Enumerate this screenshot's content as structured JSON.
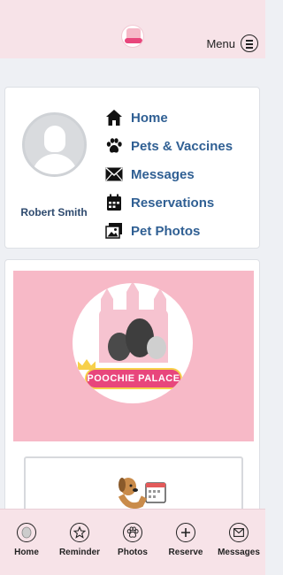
{
  "header": {
    "menu_label": "Menu"
  },
  "profile": {
    "name": "Robert Smith",
    "nav": [
      {
        "label": "Home",
        "icon": "home-icon"
      },
      {
        "label": "Pets & Vaccines",
        "icon": "paw-icon"
      },
      {
        "label": "Messages",
        "icon": "envelope-icon"
      },
      {
        "label": "Reservations",
        "icon": "calendar-icon"
      },
      {
        "label": "Pet Photos",
        "icon": "photos-icon"
      }
    ]
  },
  "logo": {
    "text": "POOCHIE PALACE"
  },
  "bottom_nav": [
    {
      "label": "Home",
      "icon": "home-circle-icon"
    },
    {
      "label": "Reminder",
      "icon": "star-icon"
    },
    {
      "label": "Photos",
      "icon": "paw-icon"
    },
    {
      "label": "Reserve",
      "icon": "plus-icon"
    },
    {
      "label": "Messages",
      "icon": "envelope-icon"
    }
  ],
  "colors": {
    "brand_pink": "#f7b9c7",
    "header_bg": "#f7e3e8",
    "link_blue": "#2f5f93",
    "name_color": "#2e4a6e"
  }
}
